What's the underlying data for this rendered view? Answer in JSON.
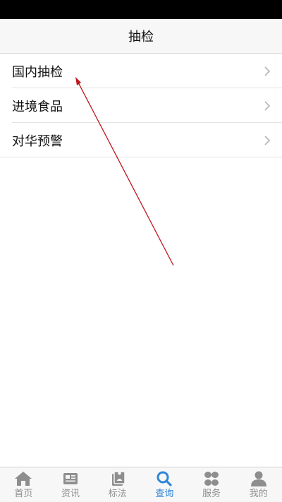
{
  "header": {
    "title": "抽检"
  },
  "menu": {
    "items": [
      {
        "label": "国内抽检"
      },
      {
        "label": "进境食品"
      },
      {
        "label": "对华预警"
      }
    ]
  },
  "annotation": {
    "color": "#c0151b"
  },
  "tabbar": {
    "active_color": "#2f86d6",
    "inactive_color": "#8e8e8e",
    "tabs": [
      {
        "label": "首页",
        "icon": "home-icon"
      },
      {
        "label": "资讯",
        "icon": "news-icon"
      },
      {
        "label": "标法",
        "icon": "standards-icon"
      },
      {
        "label": "查询",
        "icon": "search-icon",
        "active": true
      },
      {
        "label": "服务",
        "icon": "services-icon"
      },
      {
        "label": "我的",
        "icon": "profile-icon"
      }
    ]
  }
}
